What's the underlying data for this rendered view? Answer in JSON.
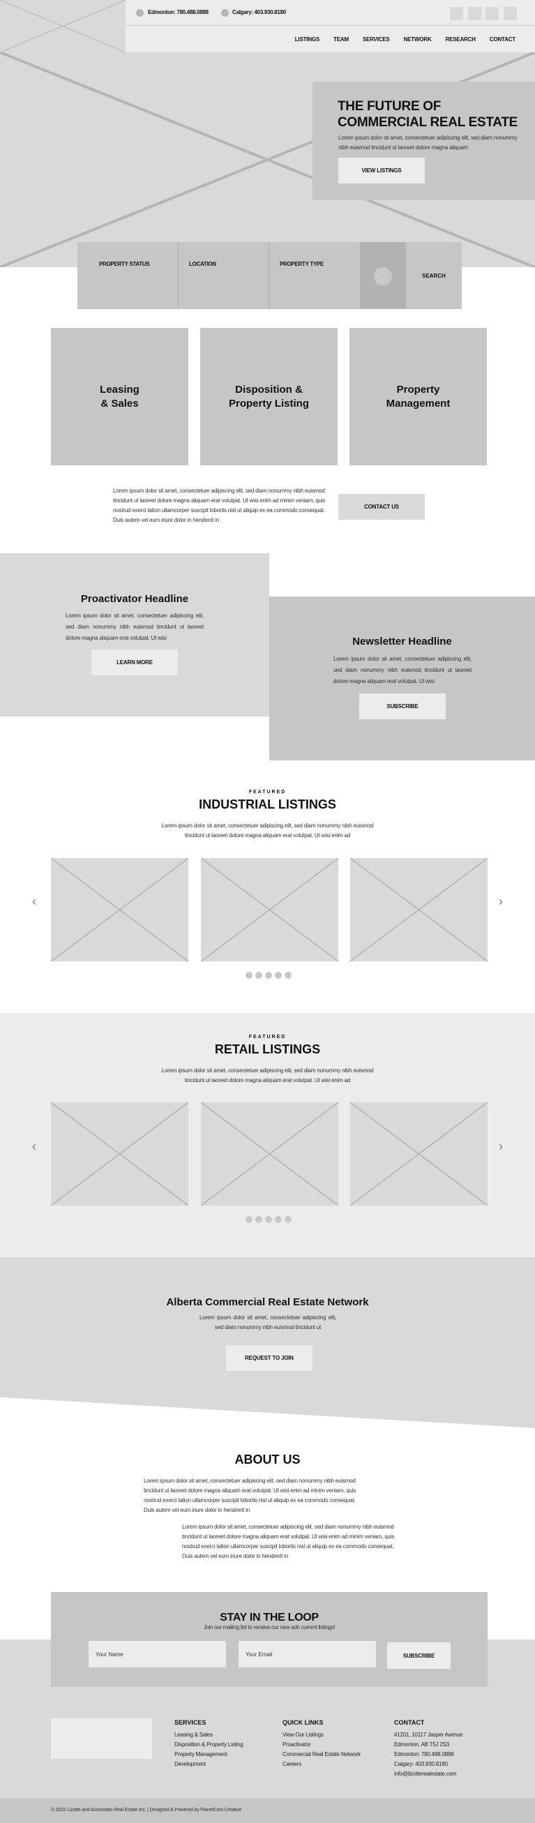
{
  "header": {
    "phone_edmonton": "Edmonton: 780.488.0888",
    "phone_calgary": "Calgary: 403.930.8180",
    "nav": [
      "LISTINGS",
      "TEAM",
      "SERVICES",
      "NETWORK",
      "RESEARCH",
      "CONTACT"
    ]
  },
  "hero": {
    "title_line1": "THE FUTURE OF",
    "title_line2": "COMMERCIAL REAL ESTATE",
    "text": "Lorem ipsum dolor sit amet, consectetuer adipiscing elit, sed diam nonummy nibh euismod tincidunt ut laoreet dolore magna aliquam",
    "button": "VIEW LISTINGS"
  },
  "search": {
    "fields": [
      "PROPERTY STATUS",
      "LOCATION",
      "PROPERTY TYPE"
    ],
    "button": "SEARCH"
  },
  "services": [
    "Leasing\n& Sales",
    "Disposition &\nProperty Listing",
    "Property\nManagement"
  ],
  "intro": {
    "text": "Lorem ipsum dolor sit amet, consectetuer adipiscing elit, sed diam nonummy nibh euismod tincidunt ut laoreet dolore magna aliquam erat volutpat. Ut wisi enim ad minim veniam, quis nostrud exerci tation ullamcorper suscipit lobortis nisl ut aliquip ex ea commodo consequat. Duis autem vel eum iriure dolor in hendrerit in",
    "button": "CONTACT US"
  },
  "proactivator": {
    "title": "Proactivator Headline",
    "text": "Lorem ipsum dolor sit amet, consectetuer adipiscing elit, sed diam nonummy nibh euismod tincidunt ut laoreet dolore magna aliquam erat volutpat. Ut wisi",
    "button": "LEARN MORE"
  },
  "newsletter": {
    "title": "Newsletter Headline",
    "text": "Lorem ipsum dolor sit amet, consectetuer adipiscing elit, sed diam nonummy nibh euismod tincidunt ut laoreet dolore magna aliquam erat volutpat. Ut wisi",
    "button": "SUBSCRIBE"
  },
  "industrial": {
    "kicker": "FEATURED",
    "title": "INDUSTRIAL LISTINGS",
    "text": "Lorem ipsum dolor sit amet, consectetuer adipiscing elit, sed diam nonummy nibh euismod tincidunt ut laoreet dolore magna aliquam erat volutpat. Ut wisi enim ad",
    "arrow_prev": "‹",
    "arrow_next": "›"
  },
  "retail": {
    "kicker": "FEATURED",
    "title": "RETAIL LISTINGS",
    "text": "Lorem ipsum dolor sit amet, consectetuer adipiscing elit, sed diam nonummy nibh euismod tincidunt ut laoreet dolore magna aliquam erat volutpat. Ut wisi enim ad",
    "arrow_prev": "‹",
    "arrow_next": "›"
  },
  "network": {
    "title": "Alberta Commercial Real Estate Network",
    "text": "Lorem ipsum dolor sit amet, consectetuer adipiscing elit, sed diam nonummy nibh euismod tincidunt ut",
    "button": "REQUEST TO JOIN"
  },
  "about": {
    "title": "ABOUT US",
    "para1": "Lorem ipsum dolor sit amet, consectetuer adipiscing elit, sed diam nonummy nibh euismod tincidunt ut laoreet dolore magna aliquam erat volutpat. Ut wisi enim ad minim veniam, quis nostrud exerci tation ullamcorper suscipit lobortis nisl ut aliquip ex ea commodo consequat. Duis autem vel eum iriure dolor in hendrerit in",
    "para2": "Lorem ipsum dolor sit amet, consectetuer adipiscing elit, sed diam nonummy nibh euismod tincidunt ut laoreet dolore magna aliquam erat volutpat. Ut wisi enim ad minim veniam, quis nostrud exerci tation ullamcorper suscipit lobortis nisl ut aliquip ex ea commodo consequat. Duis autem vel eum iriure dolor in hendrerit in"
  },
  "loop": {
    "title": "STAY IN THE LOOP",
    "subtitle": "Join our mailing list to receive our new adn current listings!",
    "name_placeholder": "Your Name",
    "email_placeholder": "Your Email",
    "button": "SUBSCRIBE"
  },
  "footer": {
    "services": {
      "heading": "SERVICES",
      "items": [
        "Leasing & Sales",
        "Disposition & Property Listing",
        "Property Management",
        "Development"
      ]
    },
    "quick_links": {
      "heading": "QUICK LINKS",
      "items": [
        "View Our Listings",
        "Proactivator",
        "Commercial Real Estate Network",
        "Careers"
      ]
    },
    "contact": {
      "heading": "CONTACT",
      "items": [
        "#1201, 10117 Jasper Avenue",
        "Edmonton, AB T5J 2S3",
        "Edmonton: 780.488.0888",
        "Calgary: 403.930.8180",
        "info@lizotterealestate.com"
      ]
    },
    "copyright": "© 2022 Lizotte and Associates Real Estate Inc. | Designed & Powered by PlanetCom Creative"
  },
  "colors": {
    "light": "#ececec",
    "mid": "#d9d9d9",
    "dark": "#c6c6c4",
    "accent_dark": "#b2b2b2"
  }
}
